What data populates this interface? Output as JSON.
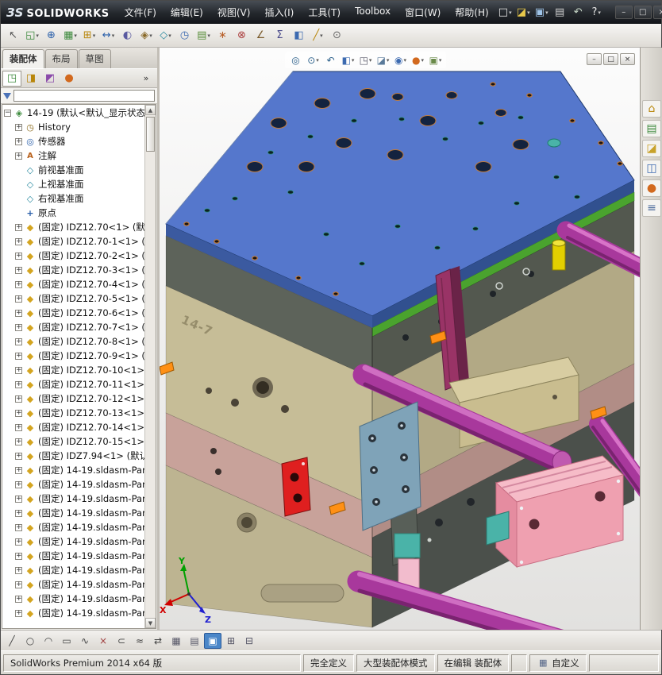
{
  "titlebar": {
    "logo_mark": "ЗS",
    "logo_text": "SOLIDWORKS",
    "menus": [
      {
        "label": "文件(F)"
      },
      {
        "label": "编辑(E)"
      },
      {
        "label": "视图(V)"
      },
      {
        "label": "插入(I)"
      },
      {
        "label": "工具(T)"
      },
      {
        "label": "Toolbox"
      },
      {
        "label": "窗口(W)"
      },
      {
        "label": "帮助(H)"
      }
    ],
    "qat": [
      {
        "name": "new-document-icon",
        "glyph": "□",
        "color": "#e8e8e8",
        "drop": true
      },
      {
        "name": "open-document-icon",
        "glyph": "◪",
        "color": "#e8c84a",
        "drop": true
      },
      {
        "name": "save-icon",
        "glyph": "▣",
        "color": "#9fc4e8",
        "drop": true
      },
      {
        "name": "print-icon",
        "glyph": "▤",
        "color": "#d0d0d0"
      },
      {
        "name": "rebuild-icon",
        "glyph": "↶",
        "color": "#c8d8c8"
      },
      {
        "name": "help-icon",
        "glyph": "?",
        "color": "#e8e8e8",
        "drop": true
      }
    ],
    "window_buttons": [
      {
        "name": "minimize-button",
        "glyph": "–"
      },
      {
        "name": "maximize-button",
        "glyph": "□"
      },
      {
        "name": "close-button",
        "glyph": "×"
      }
    ]
  },
  "main_toolbar": {
    "icons": [
      {
        "name": "select-arrow-icon",
        "glyph": "↖",
        "color": "#555555"
      },
      {
        "name": "insert-components-icon",
        "glyph": "◱",
        "color": "#3c8a3c",
        "drop": true
      },
      {
        "name": "mate-icon",
        "glyph": "⊕",
        "color": "#2a5faa"
      },
      {
        "name": "linear-component-pattern-icon",
        "glyph": "▦",
        "color": "#3c8a3c",
        "drop": true
      },
      {
        "name": "smart-fasteners-icon",
        "glyph": "⊞",
        "color": "#b8860b",
        "drop": true
      },
      {
        "name": "move-component-icon",
        "glyph": "↔",
        "color": "#2a5faa",
        "drop": true
      },
      {
        "name": "show-hidden-components-icon",
        "glyph": "◐",
        "color": "#5a5aa0"
      },
      {
        "name": "assembly-features-icon",
        "glyph": "◈",
        "color": "#8a6a2a",
        "drop": true
      },
      {
        "name": "reference-geometry-icon",
        "glyph": "◇",
        "color": "#2a8aa0",
        "drop": true
      },
      {
        "name": "new-motion-study-icon",
        "glyph": "◷",
        "color": "#3c6ab0"
      },
      {
        "name": "bill-of-materials-icon",
        "glyph": "▤",
        "color": "#5a8f3c",
        "drop": true
      },
      {
        "name": "exploded-view-icon",
        "glyph": "∗",
        "color": "#b8602a"
      },
      {
        "name": "interference-detection-icon",
        "glyph": "⊗",
        "color": "#aa3c3c"
      },
      {
        "name": "measure-icon",
        "glyph": "∠",
        "color": "#7a5a2a"
      },
      {
        "name": "mass-properties-icon",
        "glyph": "Σ",
        "color": "#4a4a8a"
      },
      {
        "name": "section-view-icon",
        "glyph": "◧",
        "color": "#3c6ab0"
      },
      {
        "name": "sketch-icon",
        "glyph": "╱",
        "color": "#b8860b",
        "drop": true
      },
      {
        "name": "options-icon",
        "glyph": "⊙",
        "color": "#666666"
      }
    ]
  },
  "command_tabs": [
    {
      "label": "装配体",
      "active": true
    },
    {
      "label": "布局"
    },
    {
      "label": "草图"
    }
  ],
  "feature_panel": {
    "toolbar": [
      {
        "name": "featuremanager-tree-icon",
        "glyph": "◳",
        "color": "#3c8a3c"
      },
      {
        "name": "propertymanager-icon",
        "glyph": "◨",
        "color": "#b8860b"
      },
      {
        "name": "configurationmanager-icon",
        "glyph": "◩",
        "color": "#8a4aaa"
      },
      {
        "name": "displaymanager-icon",
        "glyph": "●",
        "color": "#d2691e"
      },
      {
        "name": "overflow-chevron-icon",
        "glyph": "»",
        "color": "#333333"
      }
    ],
    "root": {
      "label": "14-19 (默认<默认_显示状态",
      "icon": "assembly",
      "expand": "minus"
    },
    "items": [
      {
        "icon": "history",
        "label": "History",
        "expand": "plus"
      },
      {
        "icon": "sensors",
        "label": "传感器",
        "expand": "plus"
      },
      {
        "icon": "annotations",
        "label": "注解",
        "expand": "plus"
      },
      {
        "icon": "plane",
        "label": "前视基准面",
        "expand": "none"
      },
      {
        "icon": "plane",
        "label": "上视基准面",
        "expand": "none"
      },
      {
        "icon": "plane",
        "label": "右视基准面",
        "expand": "none"
      },
      {
        "icon": "origin",
        "label": "原点",
        "expand": "none"
      },
      {
        "icon": "part",
        "label": "(固定) IDZ12.70<1> (默认",
        "expand": "plus"
      },
      {
        "icon": "part",
        "label": "(固定) IDZ12.70-1<1> (默",
        "expand": "plus"
      },
      {
        "icon": "part",
        "label": "(固定) IDZ12.70-2<1> (默",
        "expand": "plus"
      },
      {
        "icon": "part",
        "label": "(固定) IDZ12.70-3<1> (默",
        "expand": "plus"
      },
      {
        "icon": "part",
        "label": "(固定) IDZ12.70-4<1> (默",
        "expand": "plus"
      },
      {
        "icon": "part",
        "label": "(固定) IDZ12.70-5<1> (默",
        "expand": "plus"
      },
      {
        "icon": "part",
        "label": "(固定) IDZ12.70-6<1> (默",
        "expand": "plus"
      },
      {
        "icon": "part",
        "label": "(固定) IDZ12.70-7<1> (默",
        "expand": "plus"
      },
      {
        "icon": "part",
        "label": "(固定) IDZ12.70-8<1> (默",
        "expand": "plus"
      },
      {
        "icon": "part",
        "label": "(固定) IDZ12.70-9<1> (默",
        "expand": "plus"
      },
      {
        "icon": "part",
        "label": "(固定) IDZ12.70-10<1> (",
        "expand": "plus"
      },
      {
        "icon": "part",
        "label": "(固定) IDZ12.70-11<1> (",
        "expand": "plus"
      },
      {
        "icon": "part",
        "label": "(固定) IDZ12.70-12<1> (",
        "expand": "plus"
      },
      {
        "icon": "part",
        "label": "(固定) IDZ12.70-13<1> (",
        "expand": "plus"
      },
      {
        "icon": "part",
        "label": "(固定) IDZ12.70-14<1> (",
        "expand": "plus"
      },
      {
        "icon": "part",
        "label": "(固定) IDZ12.70-15<1> (",
        "expand": "plus"
      },
      {
        "icon": "part",
        "label": "(固定) IDZ7.94<1> (默认",
        "expand": "plus"
      },
      {
        "icon": "part",
        "label": "(固定) 14-19.sldasm-Par",
        "expand": "plus"
      },
      {
        "icon": "part",
        "label": "(固定) 14-19.sldasm-Par",
        "expand": "plus"
      },
      {
        "icon": "part",
        "label": "(固定) 14-19.sldasm-Par",
        "expand": "plus"
      },
      {
        "icon": "part",
        "label": "(固定) 14-19.sldasm-Par",
        "expand": "plus"
      },
      {
        "icon": "part",
        "label": "(固定) 14-19.sldasm-Par",
        "expand": "plus"
      },
      {
        "icon": "part",
        "label": "(固定) 14-19.sldasm-Par",
        "expand": "plus"
      },
      {
        "icon": "part",
        "label": "(固定) 14-19.sldasm-Par",
        "expand": "plus"
      },
      {
        "icon": "part",
        "label": "(固定) 14-19.sldasm-Par",
        "expand": "plus"
      },
      {
        "icon": "part",
        "label": "(固定) 14-19.sldasm-Par",
        "expand": "plus"
      },
      {
        "icon": "part",
        "label": "(固定) 14-19.sldasm-Par",
        "expand": "plus"
      },
      {
        "icon": "part",
        "label": "(固定) 14-19.sldasm-Par",
        "expand": "plus"
      }
    ]
  },
  "viewport": {
    "hud": [
      {
        "name": "zoom-fit-icon",
        "glyph": "◎",
        "color": "#2a5f8a"
      },
      {
        "name": "zoom-area-icon",
        "glyph": "⊙",
        "color": "#2a5f8a",
        "drop": true
      },
      {
        "name": "previous-view-icon",
        "glyph": "↶",
        "color": "#2a5f8a"
      },
      {
        "name": "section-view-icon",
        "glyph": "◧",
        "color": "#3c6ab0",
        "drop": true
      },
      {
        "name": "view-orientation-icon",
        "glyph": "◳",
        "color": "#555566",
        "drop": true
      },
      {
        "name": "display-style-icon",
        "glyph": "◪",
        "color": "#5a7a9a",
        "drop": true
      },
      {
        "name": "hide-show-items-icon",
        "glyph": "◉",
        "color": "#3c6ab0",
        "drop": true
      },
      {
        "name": "edit-appearance-icon",
        "glyph": "●",
        "color": "#d2691e",
        "drop": true
      },
      {
        "name": "apply-scene-icon",
        "glyph": "▣",
        "color": "#6a8a4a",
        "drop": true
      }
    ],
    "mdi_buttons": [
      {
        "name": "minimize-document-button",
        "glyph": "–"
      },
      {
        "name": "restore-document-button",
        "glyph": "□"
      },
      {
        "name": "close-document-button",
        "glyph": "×"
      }
    ],
    "triad": {
      "x": "X",
      "y": "Y",
      "z": "Z"
    }
  },
  "task_pane": {
    "icons": [
      {
        "name": "solidworks-resources-icon",
        "glyph": "⌂",
        "color": "#b8860b"
      },
      {
        "name": "design-library-icon",
        "glyph": "▤",
        "color": "#3c8a3c"
      },
      {
        "name": "file-explorer-icon",
        "glyph": "◪",
        "color": "#c8a22a"
      },
      {
        "name": "view-palette-icon",
        "glyph": "◫",
        "color": "#3c6ab0"
      },
      {
        "name": "appearances-icon",
        "glyph": "●",
        "color": "#d2691e"
      },
      {
        "name": "custom-properties-icon",
        "glyph": "≡",
        "color": "#4a6a9a"
      }
    ]
  },
  "bottom_toolbar": {
    "icons": [
      {
        "name": "sketch-line-icon",
        "glyph": "╱",
        "color": "#444444"
      },
      {
        "name": "sketch-circle-icon",
        "glyph": "○",
        "color": "#444444"
      },
      {
        "name": "sketch-arc-icon",
        "glyph": "◠",
        "color": "#444444"
      },
      {
        "name": "sketch-rectangle-icon",
        "glyph": "▭",
        "color": "#444444"
      },
      {
        "name": "sketch-spline-icon",
        "glyph": "∿",
        "color": "#444444"
      },
      {
        "name": "trim-entities-icon",
        "glyph": "×",
        "color": "#a04040"
      },
      {
        "name": "convert-entities-icon",
        "glyph": "⊂",
        "color": "#444444"
      },
      {
        "name": "offset-entities-icon",
        "glyph": "≈",
        "color": "#444444"
      },
      {
        "name": "mirror-entities-icon",
        "glyph": "⇄",
        "color": "#444444"
      },
      {
        "name": "grid-snap-icon",
        "glyph": "▦",
        "color": "#555566"
      },
      {
        "name": "display-grid-icon",
        "glyph": "▤",
        "color": "#555566"
      },
      {
        "name": "section-toggle-icon",
        "glyph": "▣",
        "color": "#ffffff",
        "hl": true
      },
      {
        "name": "table-icon",
        "glyph": "⊞",
        "color": "#555566"
      },
      {
        "name": "evaluate-icon",
        "glyph": "⊟",
        "color": "#555566"
      }
    ]
  },
  "statusbar": {
    "product": "SolidWorks Premium 2014 x64 版",
    "fully_defined": "完全定义",
    "mode": "大型装配体模式",
    "editing": "在编辑 装配体",
    "custom": "自定义"
  },
  "scene": {
    "engraving": "14-7",
    "colors": {
      "top_plate": "#5577cc",
      "plate_side": "#3b5aa0",
      "green_plate": "#4aa32e",
      "dark_plate": "#5d635a",
      "khaki_body": "#c6bd97",
      "khaki_side": "#b2a985",
      "rosy_plate": "#c8a29a",
      "rosy_side": "#b18d86",
      "bottom_tan": "#bdb491",
      "charcoal": "#4b504b",
      "rod_magenta": "#a8389c",
      "pink_cylinder": "#efa0b0",
      "teal": "#4ab3a8",
      "steel_blue": "#7fa3b8",
      "red_part": "#df1f1f",
      "yellow_pin": "#e3cf00",
      "orange_clip": "#ff9015",
      "hole_dark": "#13233f",
      "copper": "#c07a3a"
    }
  }
}
